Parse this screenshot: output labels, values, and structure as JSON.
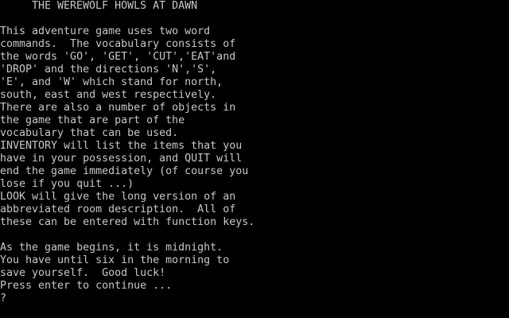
{
  "title": "THE WEREWOLF HOWLS AT DAWN",
  "colors": {
    "background": "#000000",
    "text": "#c8c8c8"
  },
  "intro_lines": [
    "This adventure game uses two word",
    "commands.  The vocabulary consists of",
    "the words 'GO', 'GET', 'CUT','EAT'and",
    "'DROP' and the directions 'N','S',",
    "'E', and 'W' which stand for north,",
    "south, east and west respectively.",
    "There are also a number of objects in",
    "the game that are part of the",
    "vocabulary that can be used.",
    "INVENTORY will list the items that you",
    "have in your possession, and QUIT will",
    "end the game immediately (of course you",
    "lose if you quit ...)",
    "LOOK will give the long version of an",
    "abbreviated room description.  All of",
    "these can be entered with function keys."
  ],
  "start_lines": [
    "As the game begins, it is midnight.",
    "You have until six in the morning to",
    "save yourself.  Good luck!"
  ],
  "continue_prompt": "Press enter to continue ...",
  "input_prompt": "?"
}
